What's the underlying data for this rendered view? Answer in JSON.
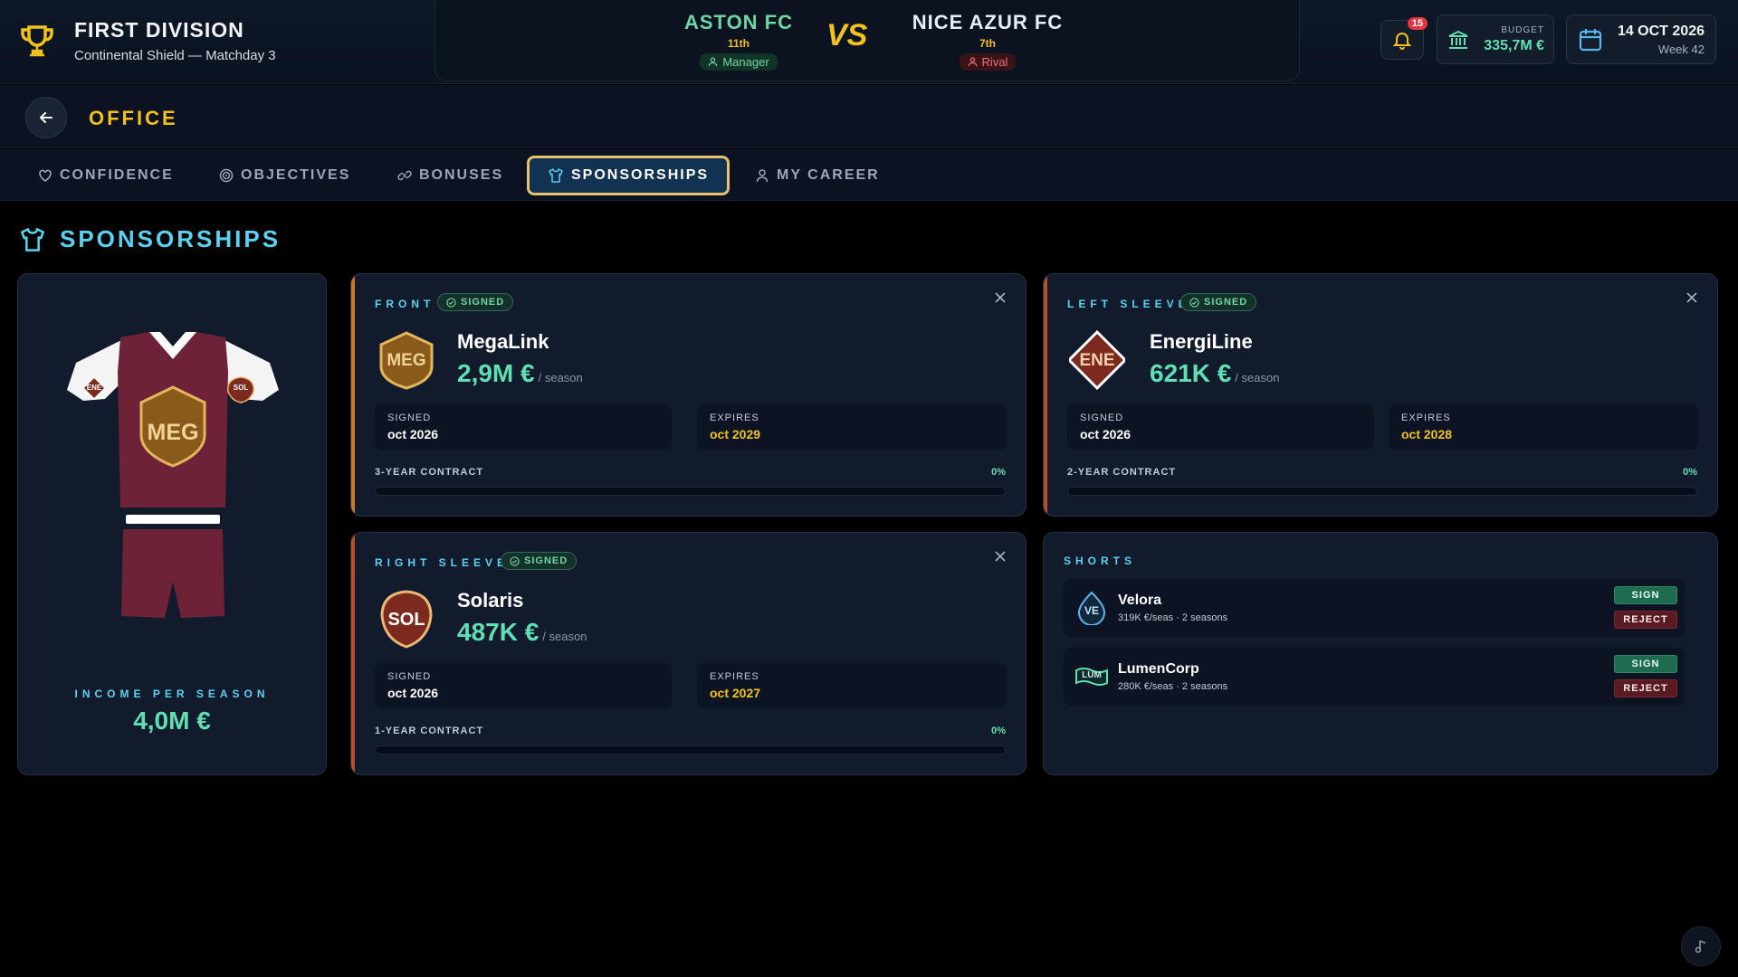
{
  "header": {
    "competition_title": "FIRST DIVISION",
    "competition_subtitle": "Continental Shield — Matchday 3",
    "home": {
      "name": "ASTON FC",
      "rank": "11th",
      "role": "Manager",
      "color": "#6fd6a2"
    },
    "vs": "VS",
    "away": {
      "name": "NICE AZUR FC",
      "rank": "7th",
      "role": "Rival",
      "color": "#ffffff"
    },
    "notifications_count": "15",
    "budget_label": "BUDGET",
    "budget_value": "335,7M €",
    "date": "14 OCT 2026",
    "week": "Week 42"
  },
  "office": {
    "title": "OFFICE"
  },
  "tabs": [
    {
      "label": "CONFIDENCE",
      "icon": "heart-icon",
      "active": false
    },
    {
      "label": "OBJECTIVES",
      "icon": "target-icon",
      "active": false
    },
    {
      "label": "BONUSES",
      "icon": "link-icon",
      "active": false
    },
    {
      "label": "SPONSORSHIPS",
      "icon": "shirt-icon",
      "active": true
    },
    {
      "label": "MY CAREER",
      "icon": "person-icon",
      "active": false
    }
  ],
  "section": {
    "title": "SPONSORSHIPS"
  },
  "jersey": {
    "chest_logo": "MEG",
    "left_sleeve_logo": "ENE",
    "right_sleeve_logo": "SOL",
    "income_label": "INCOME PER SEASON",
    "income_value": "4,0M €",
    "kit_color": "#6e2238"
  },
  "sponsors": [
    {
      "slot": "FRONT",
      "status": "SIGNED",
      "logo": "MEG",
      "name": "MegaLink",
      "amount": "2,9M €",
      "per": "/ season",
      "signed_label": "SIGNED",
      "signed_value": "oct 2026",
      "expires_label": "EXPIRES",
      "expires_value": "oct 2029",
      "contract": "3-YEAR CONTRACT",
      "progress_label": "0%",
      "progress": 0,
      "accent": "#c87a2a"
    },
    {
      "slot": "LEFT SLEEVE",
      "status": "SIGNED",
      "logo": "ENE",
      "name": "EnergiLine",
      "amount": "621K €",
      "per": "/ season",
      "signed_label": "SIGNED",
      "signed_value": "oct 2026",
      "expires_label": "EXPIRES",
      "expires_value": "oct 2028",
      "contract": "2-YEAR CONTRACT",
      "progress_label": "0%",
      "progress": 0,
      "accent": "#b5502a"
    },
    {
      "slot": "RIGHT SLEEVE",
      "status": "SIGNED",
      "logo": "SOL",
      "name": "Solaris",
      "amount": "487K €",
      "per": "/ season",
      "signed_label": "SIGNED",
      "signed_value": "oct 2026",
      "expires_label": "EXPIRES",
      "expires_value": "oct 2027",
      "contract": "1-YEAR CONTRACT",
      "progress_label": "0%",
      "progress": 0,
      "accent": "#b5502a"
    }
  ],
  "shorts": {
    "slot": "SHORTS",
    "offers": [
      {
        "logo": "VE",
        "name": "Velora",
        "meta": "319K €/seas · 2 seasons",
        "sign": "SIGN",
        "reject": "REJECT"
      },
      {
        "logo": "LUM",
        "name": "LumenCorp",
        "meta": "280K €/seas · 2 seasons",
        "sign": "SIGN",
        "reject": "REJECT"
      }
    ]
  }
}
